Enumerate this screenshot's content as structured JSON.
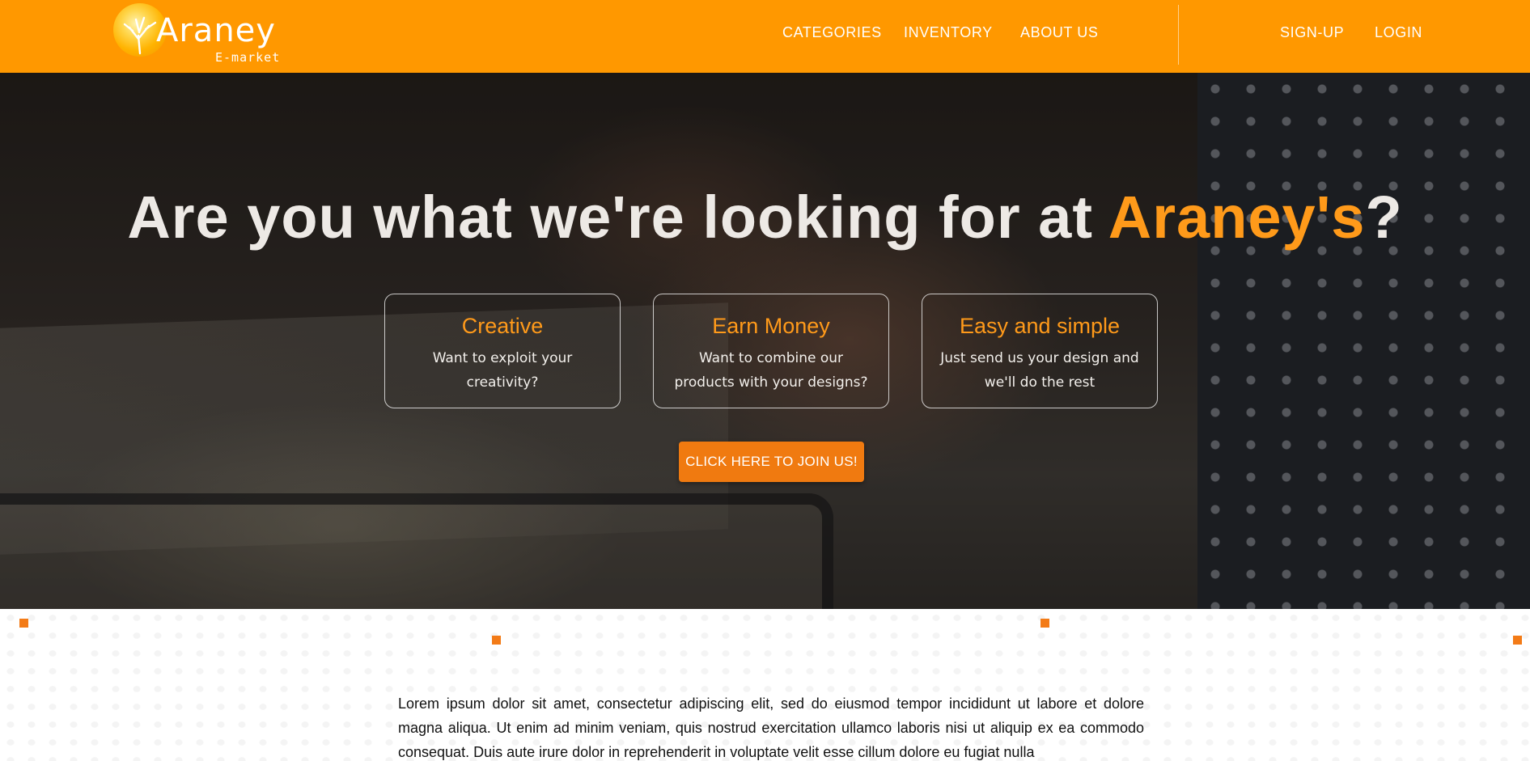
{
  "colors": {
    "navbar": "#ff9800",
    "accent": "#ff9a1a",
    "cta": "#f07a10",
    "text_light": "#ffffff",
    "body_text": "#111111"
  },
  "logo": {
    "icon": "tree-icon",
    "name": "Araney",
    "subtitle": "E-market"
  },
  "nav": {
    "items": [
      {
        "label": "CATEGORIES"
      },
      {
        "label": "INVENTORY"
      },
      {
        "label": "ABOUT US"
      }
    ],
    "auth": [
      {
        "label": "SIGN-UP"
      },
      {
        "label": "LOGIN"
      }
    ]
  },
  "hero": {
    "title_prefix": "Are you what we're looking for at ",
    "title_brand": "Araney's",
    "title_suffix": "?",
    "features": [
      {
        "title": "Creative",
        "description": "Want to exploit your creativity?"
      },
      {
        "title": "Earn Money",
        "description": "Want to combine our products with your designs?"
      },
      {
        "title": "Easy and simple",
        "description": "Just send us your design and we'll do the rest"
      }
    ],
    "cta_label": "CLICK HERE TO JOIN US!"
  },
  "content": {
    "paragraph": "Lorem ipsum dolor sit amet, consectetur adipiscing elit, sed do eiusmod tempor incididunt ut labore et dolore magna aliqua. Ut enim ad minim veniam, quis nostrud exercitation ullamco laboris nisi ut aliquip ex ea commodo consequat. Duis aute irure dolor in reprehenderit in voluptate velit esse cillum dolore eu fugiat nulla"
  }
}
